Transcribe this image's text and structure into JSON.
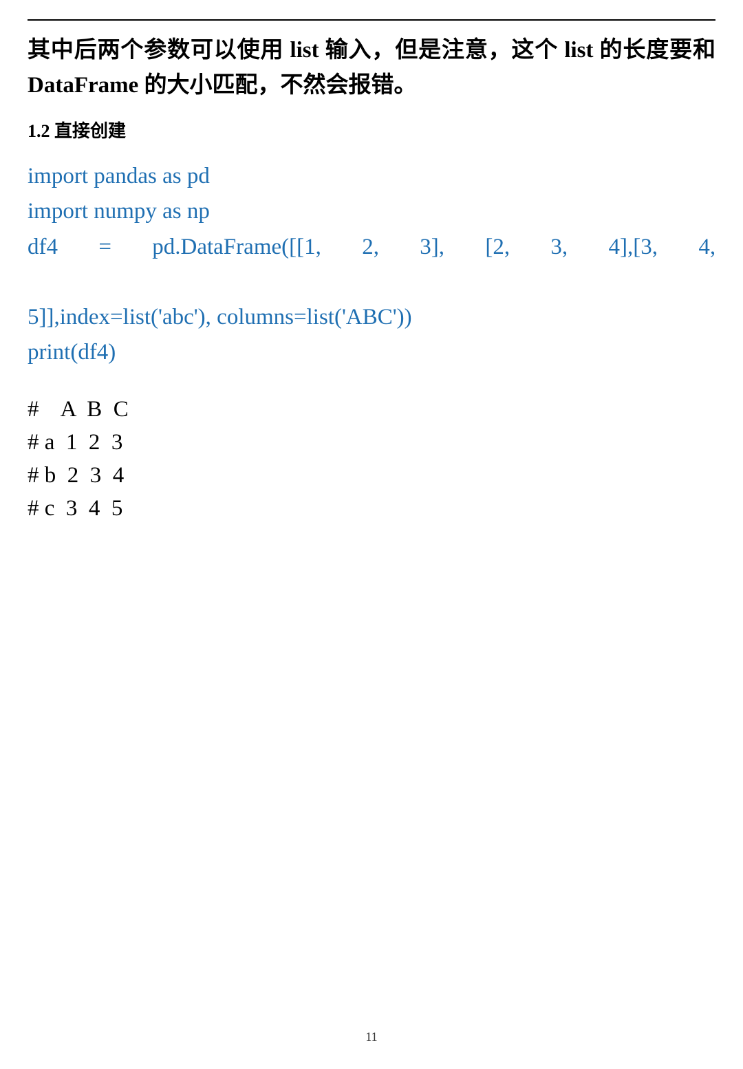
{
  "lead_paragraph": "其中后两个参数可以使用 list 输入，但是注意，这个 list 的长度要和 DataFrame 的大小匹配，不然会报错。",
  "section_heading": "1.2 直接创建",
  "code": {
    "line1": "import pandas as pd",
    "line2": "import numpy as np",
    "line3a": "df4",
    "line3b": "=",
    "line3c": "pd.DataFrame([[1,",
    "line3d": "2,",
    "line3e": "3],",
    "line3f": "[2,",
    "line3g": "3,",
    "line3h": "4],[3,",
    "line3i": "4,",
    "line4": "5]],index=list('abc'), columns=list('ABC'))",
    "line5": "print(df4)"
  },
  "output": {
    "row1": "#    A  B  C",
    "row2": "# a  1  2  3",
    "row3": "# b  2  3  4",
    "row4": "# c  3  4  5"
  },
  "page_number": "11"
}
